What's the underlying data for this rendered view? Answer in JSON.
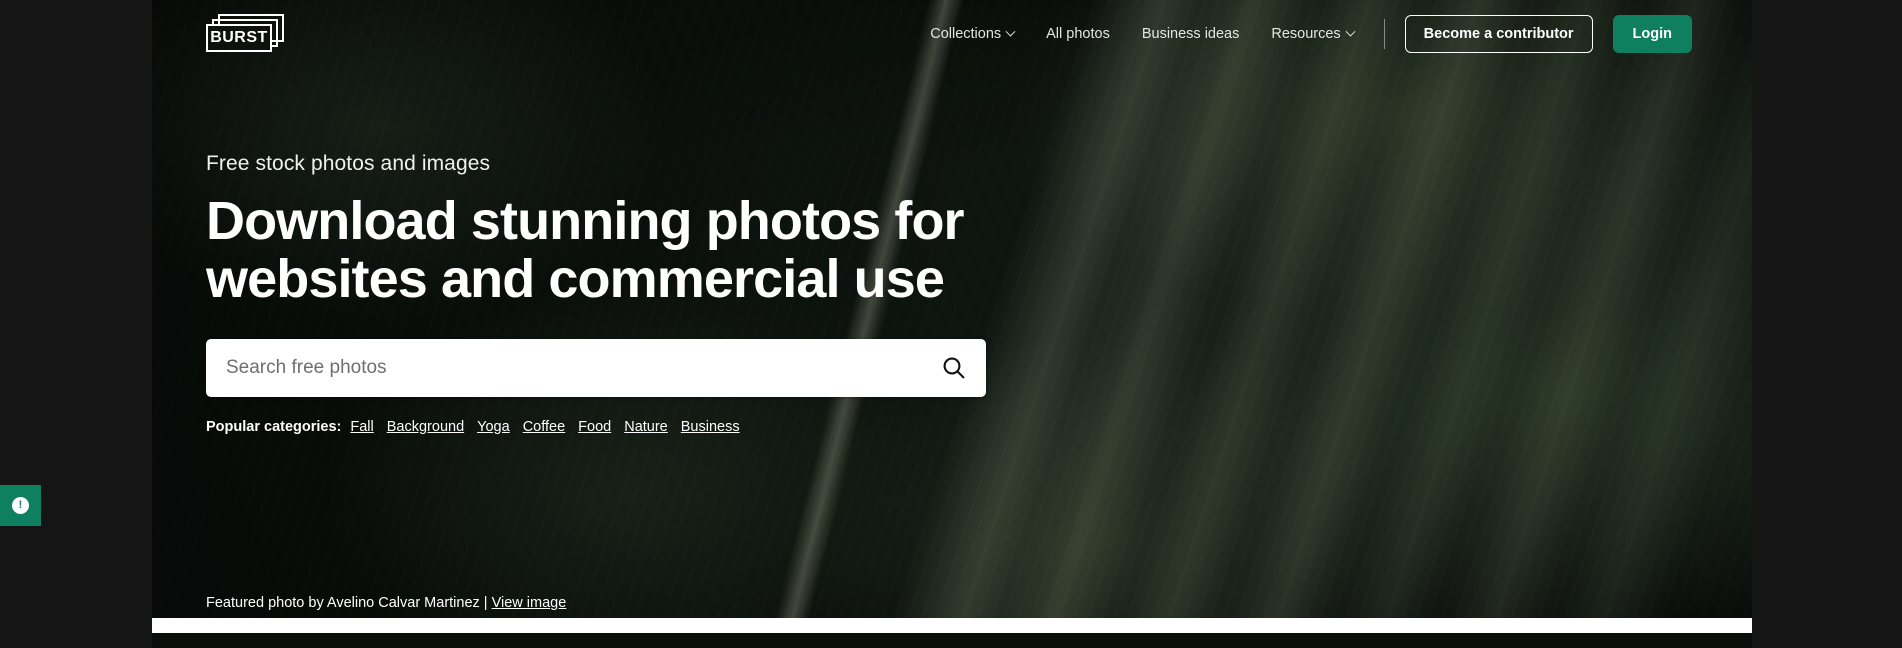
{
  "brand": {
    "wordmark": "BURST",
    "logo_icon": "stacked-frames-logo"
  },
  "header": {
    "nav_items": [
      {
        "label": "Collections",
        "has_caret": true,
        "name": "collections"
      },
      {
        "label": "All photos",
        "has_caret": false,
        "name": "all-photos"
      },
      {
        "label": "Business ideas",
        "has_caret": false,
        "name": "business-ideas"
      },
      {
        "label": "Resources",
        "has_caret": true,
        "name": "resources"
      }
    ],
    "contributor_button": "Become a contributor",
    "login_button": "Login"
  },
  "hero": {
    "eyebrow": "Free stock photos and images",
    "headline": "Download stunning photos for websites and commercial use",
    "search": {
      "placeholder": "Search free photos",
      "value": "",
      "icon": "search-icon"
    },
    "categories_label": "Popular categories:",
    "categories": [
      "Fall",
      "Background",
      "Yoga",
      "Coffee",
      "Food",
      "Nature",
      "Business"
    ],
    "credit_text": "Featured photo by Avelino Calvar Martinez |",
    "credit_link": "View image"
  },
  "feedback_tab": {
    "icon": "info-badge-icon"
  },
  "colors": {
    "accent_green": "#0e7f5f",
    "page_dark": "#151515",
    "text_light": "#ffffff"
  }
}
